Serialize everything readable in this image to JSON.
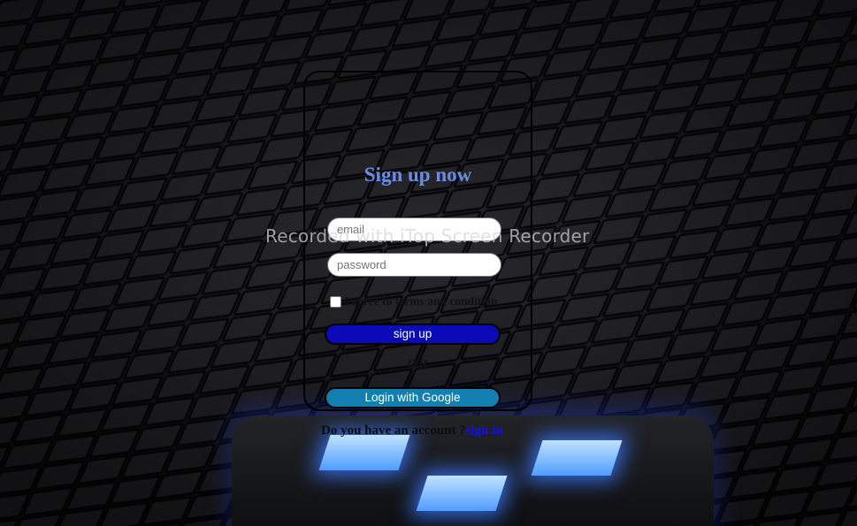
{
  "form": {
    "title": "Sign up now",
    "email_placeholder": "email",
    "password_placeholder": "password",
    "terms_label": "I agree to terms and condition",
    "terms_checked": false,
    "signup_label": "sign up",
    "or_label": "OR",
    "google_label": "Login with Google",
    "account_prompt": "Do you have an account ?",
    "signin_link": "sign in"
  },
  "watermark": "Recorded with iTop Screen Recorder",
  "colors": {
    "title": "#6a8ce6",
    "signup_button": "#0a0ab8",
    "google_button": "#127fb0",
    "signin_link": "#1010ee",
    "glow": "#3c78ff"
  }
}
